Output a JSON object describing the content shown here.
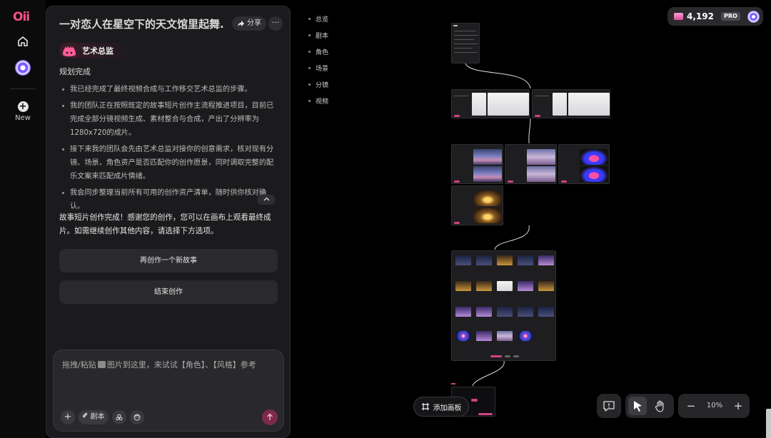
{
  "app": {
    "logo": "Oii",
    "new_label": "New"
  },
  "chat": {
    "title": "一对恋人在星空下的天文馆里起舞...",
    "share_label": "分享",
    "more_label": "···",
    "agent_name": "艺术总监",
    "status": "规划完成",
    "bullets": [
      "我已经完成了最终视频合成与工作移交艺术总监的步骤。",
      "我的团队正在按照既定的故事短片创作主流程推进项目，目前已完成全部分镜视频生成、素材整合与合成，产出了分辨率为1280x720的成片。",
      "接下来我的团队会先由艺术总监对接你的创意需求，核对现有分镜、场景、角色资产是否匹配你的创作愿景，同时调取完整的配乐文案来匹配成片情绪。",
      "我会同步整理当前所有可用的创作资产清单，随时供你核对确认。"
    ],
    "summary": "故事短片创作完成！感谢您的创作，您可以在画布上观看最终成片。如需继续创作其他内容，请选择下方选项。",
    "actions": {
      "new_story": "再创作一个新故事",
      "end": "结束创作"
    },
    "composer": {
      "placeholder_prefix": "拖拽/粘贴",
      "placeholder_suffix": "图片到这里，来试试【角色】、【风格】参考",
      "script_label": "剧本"
    }
  },
  "outline": [
    "总览",
    "剧本",
    "角色",
    "场景",
    "分镜",
    "视频"
  ],
  "credits": {
    "value": "4,192",
    "badge": "PRO"
  },
  "canvas_controls": {
    "add_board_label": "添加画板",
    "zoom_level": "10%"
  },
  "colors": {
    "accent": "#d04282",
    "panel": "#1b1b1d",
    "background": "#000000"
  }
}
